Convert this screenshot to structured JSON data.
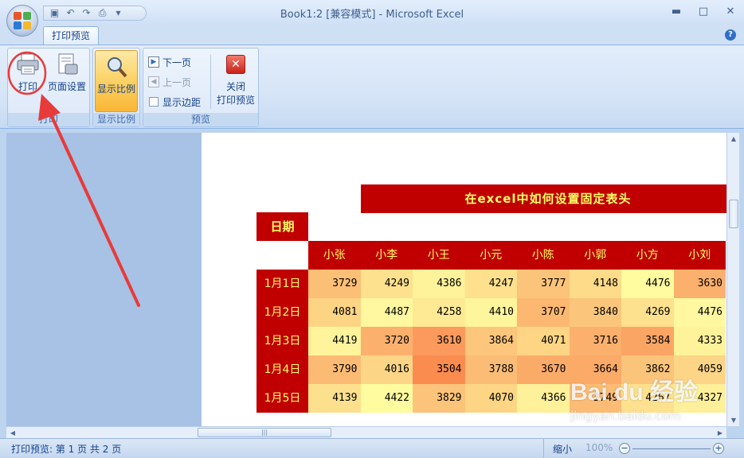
{
  "window": {
    "title": "Book1:2  [兼容模式] - Microsoft Excel",
    "minimize": "▬",
    "maximize": "□",
    "close": "✕"
  },
  "qat_icons": [
    "save-icon",
    "undo-icon",
    "redo-icon",
    "print-preview-icon",
    "customize-icon"
  ],
  "tabs": {
    "active": "打印预览",
    "help": "?"
  },
  "ribbon": {
    "groups": {
      "print": "打印",
      "zoom": "显示比例",
      "preview": "预览"
    },
    "buttons": {
      "print": "打印",
      "page_setup": "页面设置",
      "zoom": "显示比例",
      "next_page": "下一页",
      "prev_page": "上一页",
      "show_margins": "显示边距",
      "close_line1": "关闭",
      "close_line2": "打印预览"
    }
  },
  "sheet": {
    "title": "在excel中如何设置固定表头",
    "date_header": "日期",
    "names": [
      "小张",
      "小李",
      "小王",
      "小元",
      "小陈",
      "小郭",
      "小方",
      "小刘"
    ],
    "dates": [
      "1月1日",
      "1月2日",
      "1月3日",
      "1月4日",
      "1月5日"
    ],
    "rows": [
      [
        "3729",
        "4249",
        "4386",
        "4247",
        "3777",
        "4148",
        "4476",
        "3630"
      ],
      [
        "4081",
        "4487",
        "4258",
        "4410",
        "3707",
        "3840",
        "4269",
        "4476"
      ],
      [
        "4419",
        "3720",
        "3610",
        "3864",
        "4071",
        "3716",
        "3584",
        "4333"
      ],
      [
        "3790",
        "4016",
        "3504",
        "3788",
        "3670",
        "3664",
        "3862",
        "4059"
      ],
      [
        "4139",
        "4422",
        "3829",
        "4070",
        "4366",
        "3749",
        "4267",
        "4327"
      ]
    ],
    "colors": [
      [
        "#fcbf76",
        "#fee18e",
        "#fef29a",
        "#fee08d",
        "#fcc37a",
        "#fedb89",
        "#fffc9f",
        "#fcb06d"
      ],
      [
        "#fdd484",
        "#fff8a0",
        "#feea94",
        "#fef59c",
        "#fcb871",
        "#fbc67c",
        "#fee18e",
        "#fff8a0"
      ],
      [
        "#fff49c",
        "#fcb06d",
        "#fb9a5c",
        "#fcc67c",
        "#fdd584",
        "#fcb06d",
        "#fba565",
        "#fef29a"
      ],
      [
        "#fcbb74",
        "#fdd586",
        "#fa8c4f",
        "#fbbd76",
        "#fbab68",
        "#fbaa68",
        "#fbc47b",
        "#fdd586"
      ],
      [
        "#fde08d",
        "#fffb9f",
        "#fcc37a",
        "#fdd585",
        "#fff09a",
        "#fcbc75",
        "#fee18e",
        "#fef09a"
      ]
    ]
  },
  "status": {
    "left": "打印预览: 第 1 页  共 2 页",
    "zoom_label": "缩小",
    "zoom_value": "100%"
  },
  "watermark": {
    "brand": "Bai du 经验",
    "url": "jingyan.baidu.com"
  },
  "colors": {
    "header_red": "#c00000",
    "header_text": "#ffff66",
    "annotation_red": "#e83a3a"
  }
}
